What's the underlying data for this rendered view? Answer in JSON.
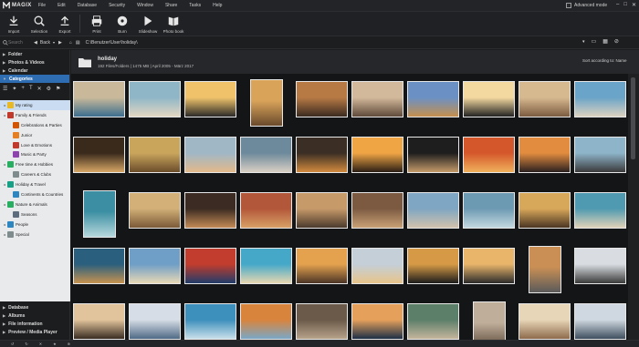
{
  "app": {
    "name": "MAGIX"
  },
  "menu": [
    "File",
    "Edit",
    "Database",
    "Security",
    "Window",
    "Share",
    "Tasks",
    "Help"
  ],
  "window": {
    "advanced_mode": "Advanced mode"
  },
  "toolbar": [
    {
      "label": "Import",
      "icon": "download-icon"
    },
    {
      "label": "Selection",
      "icon": "magnifier-icon"
    },
    {
      "label": "Export",
      "icon": "upload-icon"
    },
    {
      "label": "Print",
      "icon": "printer-icon"
    },
    {
      "label": "Burn",
      "icon": "disc-icon"
    },
    {
      "label": "Slideshow",
      "icon": "play-icon"
    },
    {
      "label": "Photo book",
      "icon": "book-icon"
    }
  ],
  "address": {
    "search_placeholder": "Search",
    "back_label": "Back",
    "path": "C:\\Benutzer\\User\\holiday\\"
  },
  "sidebar": {
    "sections_top": [
      "Folder",
      "Photos & Videos",
      "Calendar",
      "Categories"
    ],
    "tree": [
      {
        "label": "My rating",
        "color": "#e8b923",
        "level": 0,
        "selected": true
      },
      {
        "label": "Family & Friends",
        "color": "#c0392b",
        "level": 0
      },
      {
        "label": "Celebrations & Parties",
        "color": "#d35400",
        "level": 1
      },
      {
        "label": "Junior",
        "color": "#e67e22",
        "level": 1
      },
      {
        "label": "Love & Emotions",
        "color": "#c0392b",
        "level": 1
      },
      {
        "label": "Music & Party",
        "color": "#8e44ad",
        "level": 1
      },
      {
        "label": "Free time & Hobbies",
        "color": "#27ae60",
        "level": 0
      },
      {
        "label": "Careers & Clubs",
        "color": "#7f8c8d",
        "level": 1
      },
      {
        "label": "Holiday & Travel",
        "color": "#16a085",
        "level": 0
      },
      {
        "label": "Continents & Countries",
        "color": "#2e86c1",
        "level": 1
      },
      {
        "label": "Nature & Animals",
        "color": "#27ae60",
        "level": 0
      },
      {
        "label": "Seasons",
        "color": "#5d6d7e",
        "level": 1
      },
      {
        "label": "People",
        "color": "#2e86c1",
        "level": 0
      },
      {
        "label": "Special",
        "color": "#7f8c8d",
        "level": 0
      }
    ],
    "sections_bottom": [
      "Database",
      "Albums",
      "File information",
      "Preview / Media Player"
    ]
  },
  "main": {
    "folder_title": "holiday",
    "folder_meta": "192 Files/Folders | 1475 MB | April 2005 - März 2017",
    "sort_label": "Sort according to: Name"
  },
  "photos": [
    {
      "c": [
        "#c9b99a",
        "#3c6e8f"
      ]
    },
    {
      "c": [
        "#8fb6c7",
        "#e3d7c2"
      ]
    },
    {
      "c": [
        "#f0c36b",
        "#2b2a28"
      ]
    },
    {
      "c": [
        "#d9a35a",
        "#6a4a2c"
      ]
    },
    {
      "c": [
        "#b77a45",
        "#3a2a20"
      ]
    },
    {
      "c": [
        "#d3b99b",
        "#5f4a3a"
      ]
    },
    {
      "c": [
        "#6b91c4",
        "#c48f4e"
      ]
    },
    {
      "c": [
        "#f3d9a0",
        "#222222"
      ]
    },
    {
      "c": [
        "#d7b990",
        "#7c5c40"
      ]
    },
    {
      "c": [
        "#6aa4c8",
        "#dcd2c0"
      ]
    },
    {
      "c": [
        "#3a2a1c",
        "#d8a766"
      ]
    },
    {
      "c": [
        "#c9a55c",
        "#6b4d2b"
      ]
    },
    {
      "c": [
        "#a0b7c6",
        "#e3b98a"
      ]
    },
    {
      "c": [
        "#6d8a9c",
        "#d9cfc4"
      ]
    },
    {
      "c": [
        "#3b2e24",
        "#d38b3e"
      ]
    },
    {
      "c": [
        "#f0a545",
        "#2a1e14"
      ]
    },
    {
      "c": [
        "#1e1e1e",
        "#c59b6a"
      ]
    },
    {
      "c": [
        "#d4572b",
        "#f1b15c"
      ]
    },
    {
      "c": [
        "#e28c3f",
        "#2a2020"
      ]
    },
    {
      "c": [
        "#8eb4c9",
        "#3a3a3a"
      ]
    },
    {
      "c": [
        "#3c8fa3",
        "#b7d8dc"
      ]
    },
    {
      "c": [
        "#d2b077",
        "#7b5a38"
      ]
    },
    {
      "c": [
        "#3b2b22",
        "#c48a57"
      ]
    },
    {
      "c": [
        "#b3573a",
        "#d8a066"
      ]
    },
    {
      "c": [
        "#c79a6a",
        "#4a3a2c"
      ]
    },
    {
      "c": [
        "#7c5a42",
        "#c9a176"
      ]
    },
    {
      "c": [
        "#7fa6c2",
        "#d2c2ad"
      ]
    },
    {
      "c": [
        "#6d9ab3",
        "#c3d9df"
      ]
    },
    {
      "c": [
        "#d8a85a",
        "#4a3522"
      ]
    },
    {
      "c": [
        "#4f9ab0",
        "#e0d2b8"
      ]
    },
    {
      "c": [
        "#2a5f7e",
        "#c7934f"
      ]
    },
    {
      "c": [
        "#6f9ec6",
        "#e9d9b6"
      ]
    },
    {
      "c": [
        "#c23d2d",
        "#1f3c6a"
      ]
    },
    {
      "c": [
        "#45a8c9",
        "#e8d8b0"
      ]
    },
    {
      "c": [
        "#e4a24f",
        "#4b3526"
      ]
    },
    {
      "c": [
        "#c4cfd8",
        "#e7c48a"
      ]
    },
    {
      "c": [
        "#d69a46",
        "#1c1c1c"
      ]
    },
    {
      "c": [
        "#e9b56a",
        "#2b2b2b"
      ]
    },
    {
      "c": [
        "#c98f55",
        "#5a5a5a"
      ]
    },
    {
      "c": [
        "#d9dde2",
        "#3a3a3a"
      ]
    },
    {
      "c": [
        "#e2c49c",
        "#3a2c22"
      ]
    },
    {
      "c": [
        "#d6dde6",
        "#4f6a86"
      ]
    },
    {
      "c": [
        "#3d8fbc",
        "#c9e0ea"
      ]
    },
    {
      "c": [
        "#d9843d",
        "#7aa7c6"
      ]
    },
    {
      "c": [
        "#6b5a4a",
        "#b7a28a"
      ]
    },
    {
      "c": [
        "#e5a15c",
        "#1d2f46"
      ]
    },
    {
      "c": [
        "#5c7f6a",
        "#c4b59c"
      ]
    },
    {
      "c": [
        "#bfae9a",
        "#5f4c3c"
      ]
    },
    {
      "c": [
        "#e8d6b8",
        "#8e6b4c"
      ]
    },
    {
      "c": [
        "#cfd8e0",
        "#3f4f5f"
      ]
    }
  ]
}
